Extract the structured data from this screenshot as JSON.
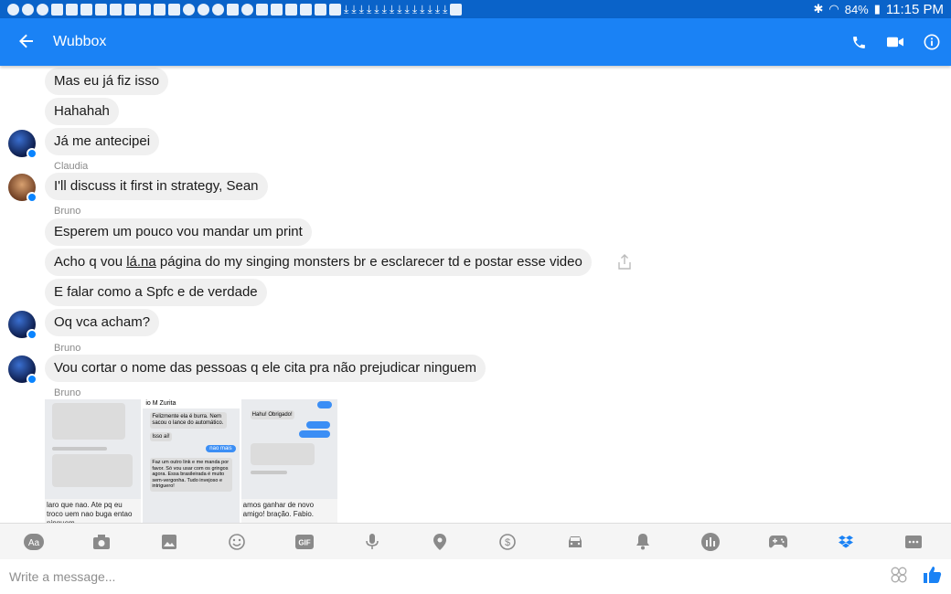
{
  "status": {
    "battery": "84%",
    "time": "11:15 PM"
  },
  "header": {
    "title": "Wubbox"
  },
  "messages": {
    "m1": "Mas eu já fiz isso",
    "m2": "Hahahah",
    "m3": "Já me antecipei",
    "sender_claudia": "Claudia",
    "m4": "I'll discuss it first in strategy, Sean",
    "sender_bruno_1": "Bruno",
    "m5": "Esperem um pouco vou mandar um print",
    "m6_a": "Acho q vou ",
    "m6_link": "lá.na",
    "m6_b": " página do my singing monsters br e esclarecer td e postar esse video",
    "m7": "E falar como a Spfc e de verdade",
    "m8": "Oq vca acham?",
    "sender_bruno_2": "Bruno",
    "m9": "Vou cortar o nome das pessoas q ele cita pra não prejudicar ninguem",
    "sender_bruno_3": "Bruno"
  },
  "thumbs": {
    "t1_caption": "laro que nao. Ate pq eu troco uem nao buga entao ninguem",
    "t2_header": "io M Zurita",
    "t2_msg1": "Felizmente ela é burra. Nem sacou o lance do automático.",
    "t2_msg2": "Isso aí!",
    "t2_msg3": "Faz um outro link e me manda por favor. Só vou usar com os gringos agora. Essa brasileirada é muito sem-vergonha. Tudo invejoso e intriguero!",
    "t2_blue": "nao mais",
    "t3_msg1": "Hahu! Obrigado!",
    "t3_caption": "amos ganhar de novo amigo! bração. Fabio."
  },
  "composer": {
    "placeholder": "Write a message..."
  },
  "colors": {
    "statusbar": "#0a63c9",
    "appbar": "#1a82f5",
    "bubble": "#f0f0f0",
    "accent": "#0a84ff"
  },
  "icons": {
    "toolbar": [
      "text-icon",
      "camera-icon",
      "gallery-icon",
      "emoji-icon",
      "gif-icon",
      "microphone-icon",
      "location-icon",
      "payment-icon",
      "car-icon",
      "bell-icon",
      "poll-icon",
      "game-icon",
      "dropbox-icon",
      "more-icon"
    ]
  }
}
